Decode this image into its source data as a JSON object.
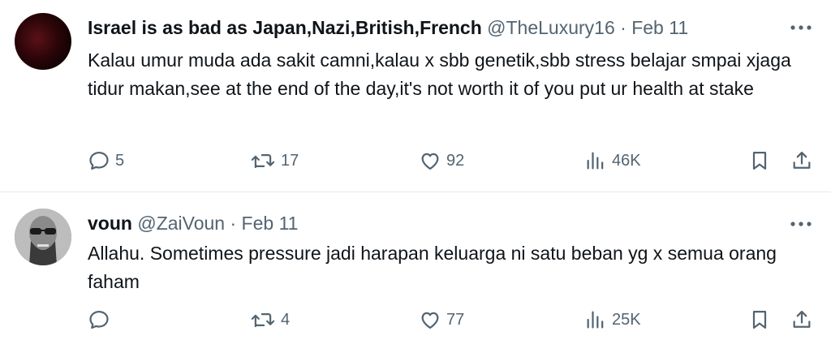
{
  "tweets": [
    {
      "display_name": "Israel is as bad as Japan,Nazi,British,French",
      "handle": "@TheLuxury16",
      "date": "Feb 11",
      "text": "Kalau umur muda ada sakit camni,kalau x sbb genetik,sbb stress belajar smpai xjaga tidur makan,see at the end of the day,it's not worth it of you put ur health at stake",
      "replies": "5",
      "retweets": "17",
      "likes": "92",
      "views": "46K"
    },
    {
      "display_name": "voun",
      "handle": "@ZaiVoun",
      "date": "Feb 11",
      "text": "Allahu. Sometimes pressure jadi harapan keluarga ni satu beban yg x semua orang faham",
      "replies": "",
      "retweets": "4",
      "likes": "77",
      "views": "25K"
    }
  ],
  "separator": " · ",
  "icons": [
    "more-icon",
    "reply-icon",
    "retweet-icon",
    "like-icon",
    "views-icon",
    "bookmark-icon",
    "share-icon"
  ],
  "colors": {
    "text": "#0f1419",
    "muted": "#536471",
    "divider": "#e6e9eb"
  }
}
